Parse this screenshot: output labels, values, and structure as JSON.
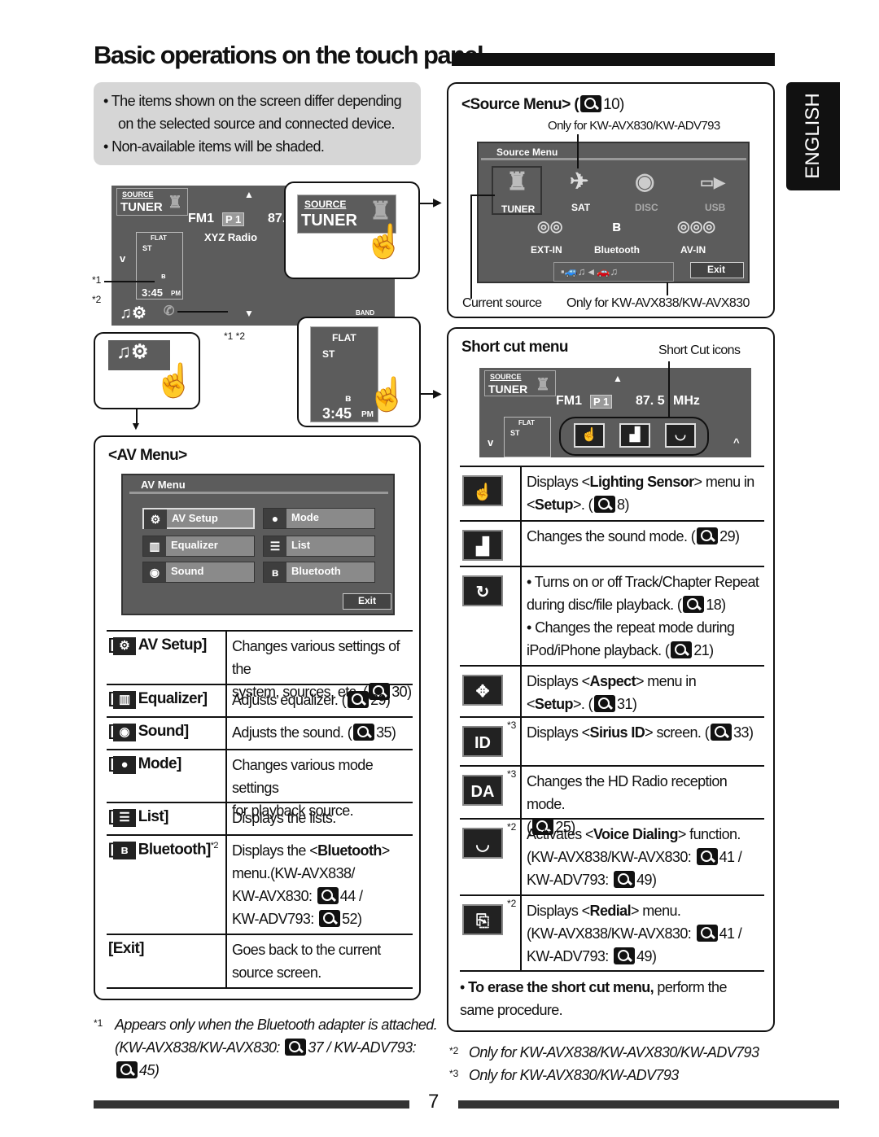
{
  "title": "Basic operations on the touch panel",
  "language_tab": "ENGLISH",
  "notes": [
    "The items shown on the screen differ depending\non the selected source and connected device.",
    "Non-available items will be shaded."
  ],
  "main_screen": {
    "source_label": "SOURCE",
    "source_value": "TUNER",
    "band": "FM1",
    "preset": "P 1",
    "freq_partial": "87.",
    "station": "XYZ Radio",
    "sound_mode": "FLAT",
    "stereo": "ST",
    "clock": "3:45",
    "ampm": "PM",
    "band_button": "BAND",
    "marker_1": "*1",
    "marker_2": "*2",
    "marker_12": "*1 *2"
  },
  "av_menu": {
    "heading": "<AV Menu>",
    "screen_title": "AV Menu",
    "buttons": [
      "AV Setup",
      "Mode",
      "Equalizer",
      "List",
      "Sound",
      "Bluetooth"
    ],
    "exit": "Exit",
    "rows": [
      {
        "label": "AV Setup]",
        "desc": [
          "Changes various settings of the\nsystem, sources, etc. (",
          {
            "ref": "30"
          },
          ")"
        ]
      },
      {
        "label": "Equalizer]",
        "desc": [
          "Adjusts equalizer. (",
          {
            "ref": "29"
          },
          ")"
        ]
      },
      {
        "label": "Sound]",
        "desc": [
          "Adjusts the sound. (",
          {
            "ref": "35"
          },
          ")"
        ]
      },
      {
        "label": "Mode]",
        "desc": [
          "Changes various mode settings\nfor playback source."
        ]
      },
      {
        "label": "List]",
        "desc": [
          "Displays the lists."
        ]
      },
      {
        "label": "Bluetooth]",
        "sup": "*2",
        "desc": [
          "Displays the <",
          {
            "b": "Bluetooth"
          },
          ">\nmenu.(KW-AVX838/\nKW-AVX830: ",
          {
            "ref": "44"
          },
          " /\nKW-ADV793: ",
          {
            "ref": "52"
          },
          ")"
        ]
      },
      {
        "label": "[Exit]",
        "desc": [
          "Goes back to the current\nsource screen."
        ]
      }
    ]
  },
  "source_menu": {
    "heading": "<Source Menu> (",
    "ref": "10",
    "note_top": "Only for KW-AVX830/KW-ADV793",
    "screen_title": "Source Menu",
    "items": [
      "TUNER",
      "SAT",
      "DISC",
      "USB",
      "EXT-IN",
      "Bluetooth",
      "AV-IN"
    ],
    "exit": "Exit",
    "current_source": "Current source",
    "note_bottom": "Only for KW-AVX838/KW-AVX830"
  },
  "shortcut": {
    "heading": "Short cut menu",
    "icons_label": "Short Cut icons",
    "screen": {
      "source_label": "SOURCE",
      "source_value": "TUNER",
      "band": "FM1",
      "preset": "P 1",
      "freq": "87. 5",
      "unit": "MHz",
      "sound_mode": "FLAT",
      "stereo": "ST"
    },
    "rows": [
      {
        "icon": "lighting-sensor",
        "glyph": "☝",
        "desc": [
          "Displays <",
          {
            "b": "Lighting Sensor"
          },
          "> menu in\n<",
          {
            "b": "Setup"
          },
          ">. (",
          {
            "ref": "8"
          },
          ")"
        ]
      },
      {
        "icon": "sound-mode",
        "glyph": "▟",
        "desc": [
          "Changes the sound mode. (",
          {
            "ref": "29"
          },
          ")"
        ]
      },
      {
        "icon": "repeat",
        "glyph": "↻",
        "desc": [
          "• Turns on or off Track/Chapter Repeat\n   during disc/file playback. (",
          {
            "ref": "18"
          },
          ")\n• Changes the repeat mode during\n   iPod/iPhone playback. (",
          {
            "ref": "21"
          },
          ")"
        ]
      },
      {
        "icon": "aspect",
        "glyph": "✥",
        "desc": [
          "Displays <",
          {
            "b": "Aspect"
          },
          ">  menu in\n<",
          {
            "b": "Setup"
          },
          ">. (",
          {
            "ref": "31"
          },
          ")"
        ]
      },
      {
        "icon": "sirius-id",
        "glyph": "ID",
        "sup": "*3",
        "desc": [
          "Displays <",
          {
            "b": "Sirius ID"
          },
          "> screen. (",
          {
            "ref": "33"
          },
          ")"
        ]
      },
      {
        "icon": "hd-radio",
        "glyph": "DA",
        "sup": "*3",
        "desc": [
          "Changes the HD Radio reception mode.\n(",
          {
            "ref": "25"
          },
          ")"
        ]
      },
      {
        "icon": "voice-dialing",
        "glyph": "◡",
        "sup": "*2",
        "desc": [
          "Activates <",
          {
            "b": "Voice Dialing"
          },
          "> function.\n(KW-AVX838/KW-AVX830: ",
          {
            "ref": "41"
          },
          " /\nKW-ADV793: ",
          {
            "ref": "49"
          },
          ")"
        ]
      },
      {
        "icon": "redial",
        "glyph": "⎘",
        "sup": "*2",
        "desc": [
          "Displays <",
          {
            "b": "Redial"
          },
          "> menu.\n(KW-AVX838/KW-AVX830: ",
          {
            "ref": "41"
          },
          " /\nKW-ADV793: ",
          {
            "ref": "49"
          },
          ")"
        ]
      }
    ],
    "erase_note": [
      "• ",
      {
        "b": "To erase the short cut menu,"
      },
      " perform the\n   same procedure."
    ]
  },
  "footnotes": {
    "fn1_mark": "*1",
    "fn1": [
      "Appears only when the Bluetooth adapter is attached.\n(KW-AVX838/KW-AVX830: ",
      {
        "ref": "37"
      },
      " / KW-ADV793:\n",
      {
        "ref": "45"
      },
      ")"
    ],
    "fn2_mark": "*2",
    "fn2": "Only for KW-AVX838/KW-AVX830/KW-ADV793",
    "fn3_mark": "*3",
    "fn3": "Only for KW-AVX830/KW-ADV793"
  },
  "page_number": "7"
}
